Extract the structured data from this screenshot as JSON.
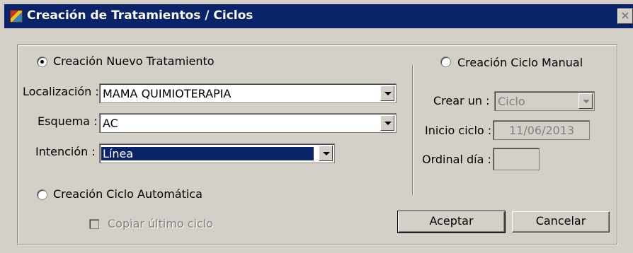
{
  "window": {
    "title": "Creación de Tratamientos / Ciclos",
    "close_label": "×"
  },
  "nuevo_tratamiento": {
    "radio_label": "Creación Nuevo Tratamiento",
    "checked": true,
    "localizacion": {
      "label": "Localización :",
      "value": "MAMA QUIMIOTERAPIA"
    },
    "esquema": {
      "label": "Esquema :",
      "value": "AC"
    },
    "intencion": {
      "label": "Intención :",
      "value": "Línea"
    }
  },
  "ciclo_automatico": {
    "radio_label": "Creación Ciclo Automática",
    "checked": false,
    "copiar_label": "Copiar último ciclo",
    "copiar_checked": false
  },
  "ciclo_manual": {
    "radio_label": "Creación Ciclo Manual",
    "checked": false,
    "crear_un": {
      "label": "Crear un :",
      "value": "Ciclo"
    },
    "inicio_ciclo": {
      "label": "Inicio ciclo :",
      "value": "11/06/2013"
    },
    "ordinal_dia": {
      "label": "Ordinal día :",
      "value": ""
    }
  },
  "buttons": {
    "aceptar": "Aceptar",
    "cancelar": "Cancelar"
  }
}
